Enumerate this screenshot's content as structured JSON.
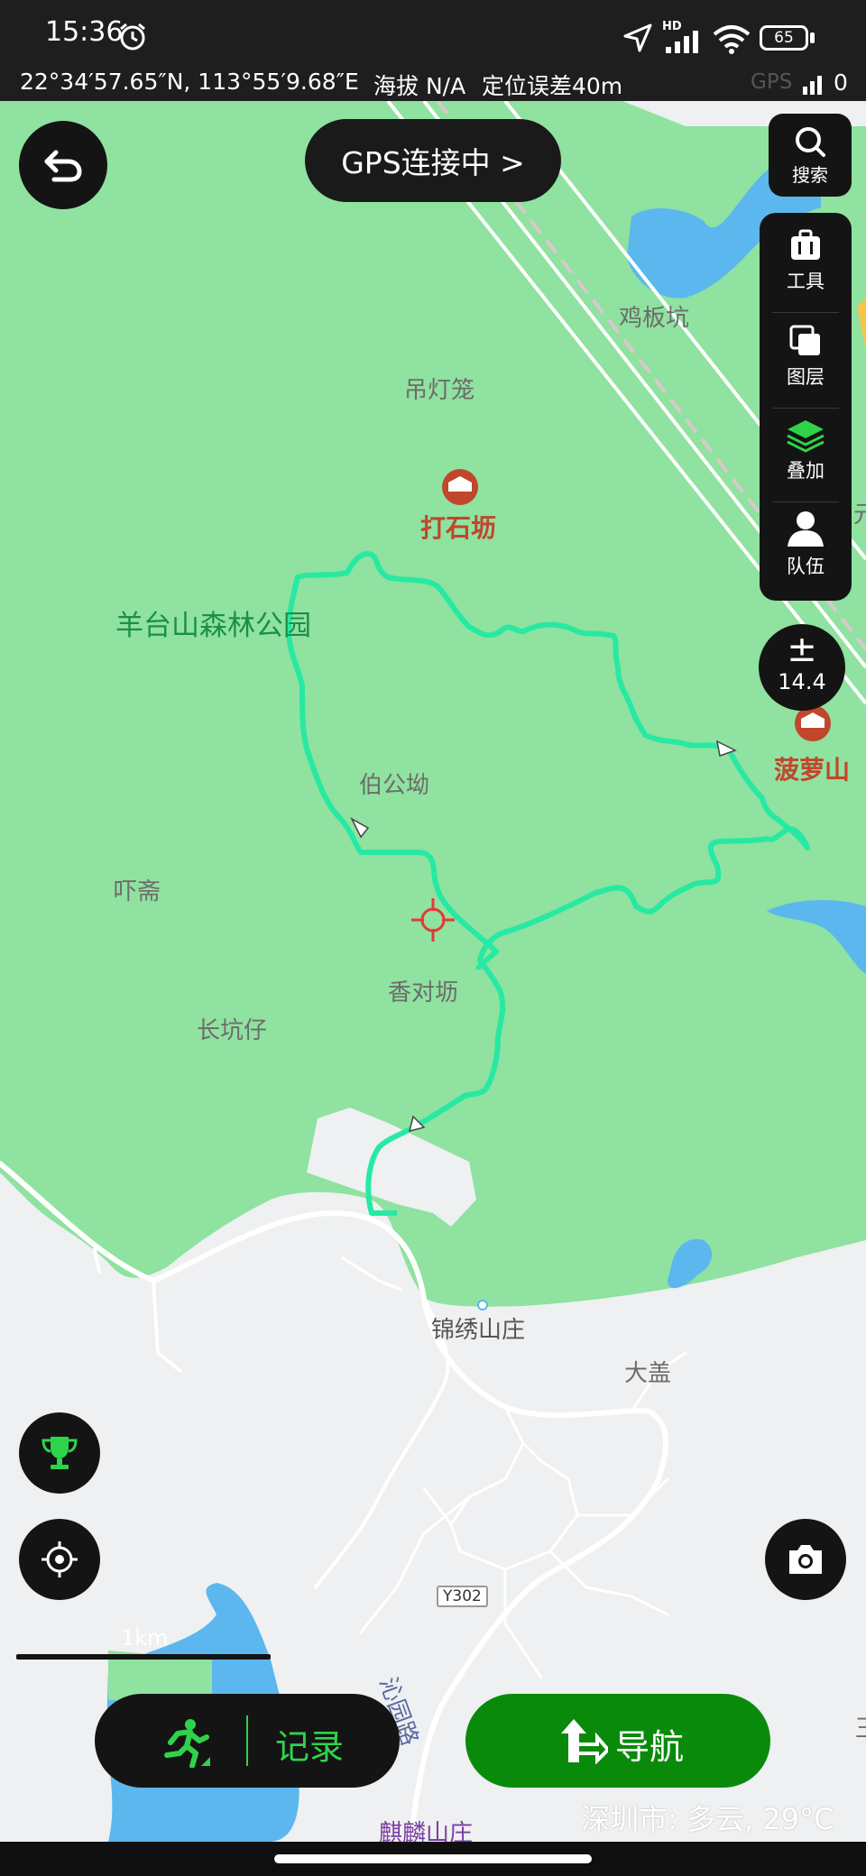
{
  "status": {
    "time": "15:36",
    "battery": "65",
    "hd": "HD"
  },
  "coords": {
    "position": "22°34′57.65″N, 113°55′9.68″E",
    "altitude": "海拔 N/A",
    "accuracy": "定位误差40m",
    "gps_label": "GPS",
    "gps_count": "0"
  },
  "header": {
    "gps_status": "GPS连接中 >"
  },
  "toolbar": {
    "search": "搜索",
    "tools": "工具",
    "layers": "图层",
    "overlay": "叠加",
    "team": "队伍"
  },
  "zoom": {
    "symbol": "±",
    "level": "14.4"
  },
  "map_labels": {
    "jibankeng": "鸡板坑",
    "diaodenglong": "吊灯笼",
    "dashifang": "打石坜",
    "park": "羊台山森林公园",
    "bogongao": "伯公坳",
    "boluoshan": "菠萝山",
    "xiazhai": "吓斋",
    "xiangduifang": "香对坜",
    "changkengzai": "长坑仔",
    "jinxiu": "锦绣山庄",
    "dagai": "大盖",
    "road_code": "Y302",
    "qinyuan": "沁园路",
    "qilin": "麒麟山庄",
    "edge_yuan": "元",
    "edge_wang": "王"
  },
  "scale": {
    "label": "1km"
  },
  "bottom": {
    "record": "记录",
    "navigate": "导航"
  },
  "weather": "深圳市: 多云, 29°C",
  "colors": {
    "park_green": "#8fe29f",
    "track": "#27e9a3",
    "water": "#5cb7ee",
    "nav_green": "#0a8a0a",
    "accent_green": "#2fd34a",
    "poi": "#c0472b"
  },
  "icons": [
    "back-icon",
    "search-icon",
    "briefcase-icon",
    "layers-copy-icon",
    "stack-icon",
    "person-icon",
    "trophy-icon",
    "locate-icon",
    "camera-icon",
    "runner-icon",
    "nav-arrow-icon",
    "alarm-icon",
    "location-arrow-icon",
    "signal-icon",
    "wifi-icon",
    "battery-icon"
  ]
}
